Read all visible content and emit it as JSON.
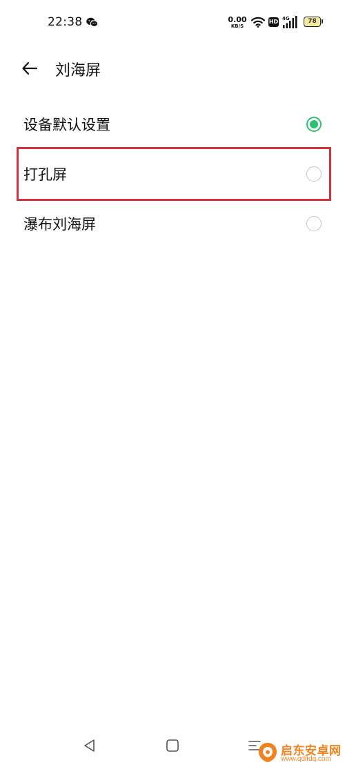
{
  "status_bar": {
    "time": "22:38",
    "net_speed_value": "0.00",
    "net_speed_unit": "KB/S",
    "hd_label": "HD",
    "cell_label": "4G",
    "battery_level": "78",
    "icons": [
      "wechat-icon",
      "wifi-icon",
      "hd-icon",
      "cellular-signal-icon",
      "battery-icon"
    ]
  },
  "header": {
    "title": "刘海屏",
    "back_icon": "arrow-left-icon"
  },
  "options": [
    {
      "label": "设备默认设置",
      "selected": true
    },
    {
      "label": "打孔屏",
      "selected": false
    },
    {
      "label": "瀑布刘海屏",
      "selected": false
    }
  ],
  "colors": {
    "accent": "#2fbf71",
    "highlight": "#d4323d",
    "radio_border": "#c6c6c6",
    "watermark": "#f0831f"
  },
  "nav_bar": {
    "icons": [
      "nav-back-icon",
      "nav-home-icon",
      "nav-menu-icon"
    ]
  },
  "watermark": {
    "name": "启东安卓网",
    "url": "www.qdltdq.com"
  }
}
